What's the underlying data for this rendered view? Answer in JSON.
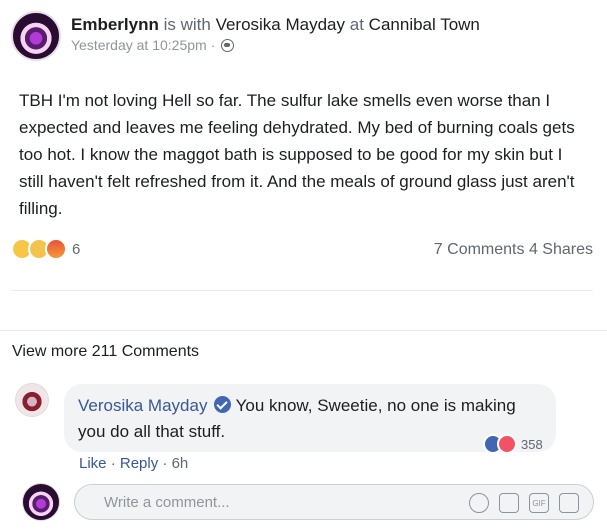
{
  "post": {
    "author": "Emberlynn",
    "with_text": "is with",
    "tagged": "Verosika Mayday",
    "at_text": "at",
    "location": "Cannibal Town",
    "timestamp": "Yesterday at 10:25pm",
    "separator": "·",
    "body": "TBH I'm not loving Hell so far. The sulfur lake smells even worse than I expected and leaves me feeling dehydrated. My bed of burning coals gets too hot. I know the maggot bath is supposed to be good for my skin but I still haven't felt refreshed from it. And the meals of ground glass just aren't filling."
  },
  "reactions": {
    "icons": [
      "wow-icon",
      "sad-icon",
      "angry-icon"
    ],
    "count": "6",
    "comments": "7 Comments",
    "shares": "4 Shares"
  },
  "comments": {
    "view_more": "View more 211 Comments",
    "items": [
      {
        "author": "Verosika Mayday",
        "text": "You know, Sweetie, no one is making you do all that stuff.",
        "reaction_icons": [
          "like-icon",
          "love-icon"
        ],
        "reaction_count": "358",
        "like": "Like",
        "reply": "Reply",
        "sep": "·",
        "time": "6h"
      }
    ]
  },
  "composer": {
    "placeholder": "Write a comment...",
    "icons": [
      "emoji-icon",
      "camera-icon",
      "gif-icon",
      "sticker-icon"
    ],
    "gif_label": "GIF"
  },
  "colors": {
    "link": "#385898",
    "text": "#1c1e21",
    "muted": "#606770"
  }
}
